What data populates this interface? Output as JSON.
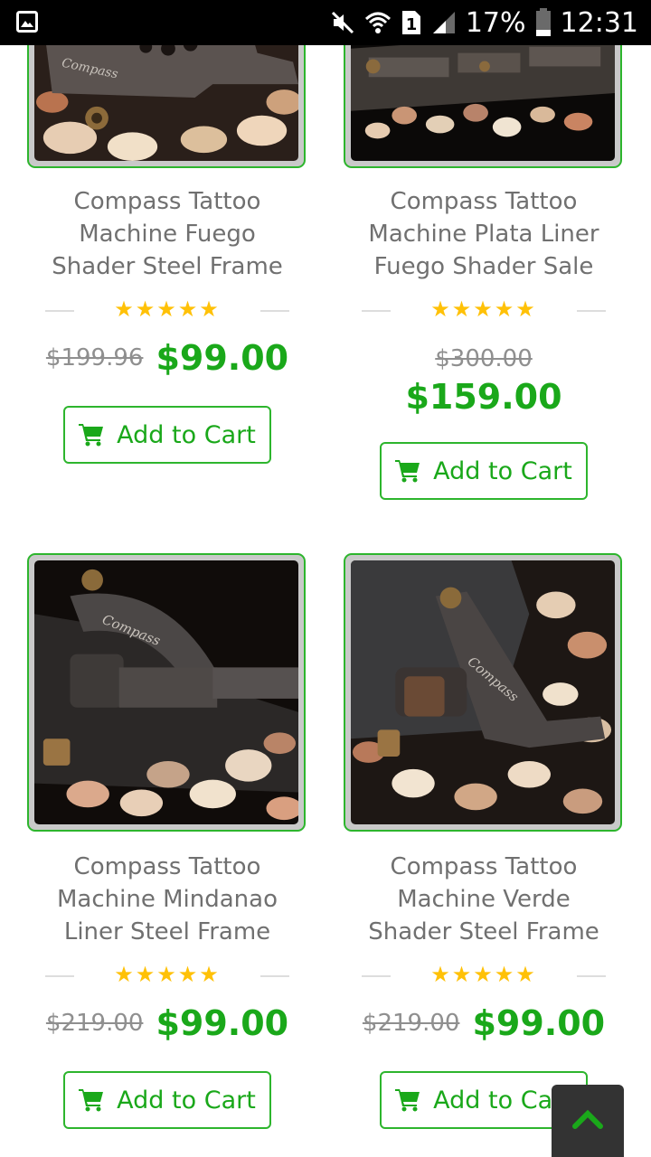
{
  "status_bar": {
    "icons": [
      "gallery-icon",
      "mute-icon",
      "wifi-icon",
      "sim-icon",
      "signal-icon",
      "battery-icon"
    ],
    "sim_label": "1",
    "battery": "17%",
    "time": "12:31"
  },
  "products": [
    {
      "title": [
        "Compass Tattoo",
        "Machine Fuego",
        "Shader Steel Frame"
      ],
      "rating": "★★★★★",
      "old_price": "$199.96",
      "new_price": "$99.00",
      "cart_label": "Add to Cart"
    },
    {
      "title": [
        "Compass Tattoo",
        "Machine Plata Liner",
        "Fuego Shader Sale"
      ],
      "rating": "★★★★★",
      "old_price": "$300.00",
      "new_price": "$159.00",
      "cart_label": "Add to Cart"
    },
    {
      "title": [
        "Compass Tattoo",
        "Machine Mindanao",
        "Liner Steel Frame"
      ],
      "rating": "★★★★★",
      "old_price": "$219.00",
      "new_price": "$99.00",
      "cart_label": "Add to Cart"
    },
    {
      "title": [
        "Compass Tattoo",
        "Machine Verde",
        "Shader Steel Frame"
      ],
      "rating": "★★★★★",
      "old_price": "$219.00",
      "new_price": "$99.00",
      "cart_label": "Add to Cart"
    }
  ],
  "image_brand_text": "Compass",
  "colors": {
    "accent": "#1aa81a",
    "border": "#2db52d",
    "star": "#ffc107",
    "old_price": "#8f8f8f",
    "title": "#707070"
  },
  "back_to_top_icon": "chevron-up-icon"
}
